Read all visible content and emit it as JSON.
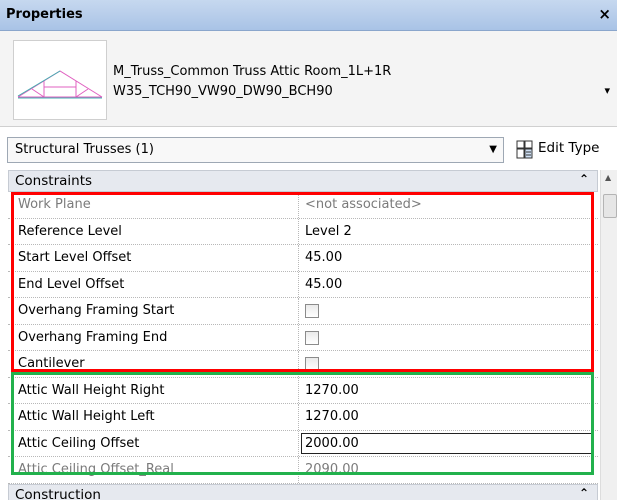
{
  "panel": {
    "title": "Properties",
    "close_glyph": "×"
  },
  "type_selector": {
    "family": "M_Truss_Common Truss Attic Room_1L+1R",
    "type": "W35_TCH90_VW90_DW90_BCH90",
    "dropdown_glyph": "▾"
  },
  "instance_selector": {
    "value": "Structural Trusses (1)",
    "arrow_glyph": "▼"
  },
  "edit_type": {
    "label": "Edit Type"
  },
  "sections": {
    "constraints": {
      "name": "Constraints",
      "glyph": "⌃"
    },
    "construction": {
      "name": "Construction",
      "glyph": "⌃"
    }
  },
  "rows": [
    {
      "name": "Work Plane",
      "value": "<not associated>",
      "readonly": true
    },
    {
      "name": "Reference Level",
      "value": "Level 2"
    },
    {
      "name": "Start Level Offset",
      "value": "45.00"
    },
    {
      "name": "End Level Offset",
      "value": "45.00"
    },
    {
      "name": "Overhang Framing Start",
      "checkbox": true,
      "checked": false
    },
    {
      "name": "Overhang Framing End",
      "checkbox": true,
      "checked": false
    },
    {
      "name": "Cantilever",
      "checkbox": true,
      "checked": false
    },
    {
      "name": "Attic Wall Height Right",
      "value": "1270.00"
    },
    {
      "name": "Attic Wall Height Left",
      "value": "1270.00"
    },
    {
      "name": "Attic Ceiling Offset",
      "value": "2000.00",
      "editing": true
    },
    {
      "name": "Attic Ceiling Offset_Real",
      "value": "2090.00",
      "readonly": true
    }
  ],
  "colors": {
    "highlight_red": "#ff0000",
    "highlight_green": "#22b14c",
    "truss": "#e060c0"
  },
  "icons": {
    "thumbnail": "truss-preview-icon",
    "edit_type": "edit-type-icon"
  }
}
